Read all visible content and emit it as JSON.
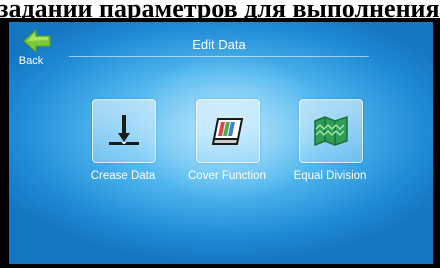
{
  "caption": {
    "text": "задании параметров для выполнения"
  },
  "header": {
    "title": "Edit Data"
  },
  "back": {
    "label": "Back",
    "icon": "arrow-left-icon",
    "color": "#7ec93a"
  },
  "menu": [
    {
      "label": "Crease Data",
      "icon": "crease-icon"
    },
    {
      "label": "Cover Function",
      "icon": "cover-icon"
    },
    {
      "label": "Equal Division",
      "icon": "equal-division-icon"
    }
  ],
  "colors": {
    "background": "#3aa8ea",
    "text": "#ffffff"
  }
}
